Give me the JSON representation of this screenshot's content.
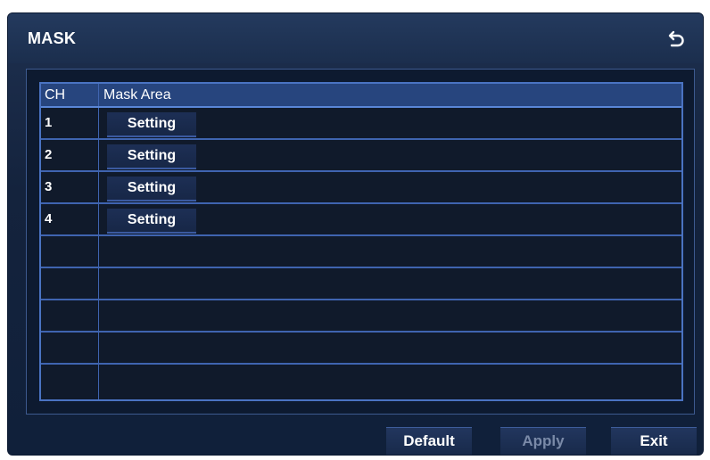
{
  "window": {
    "title": "MASK"
  },
  "table": {
    "columns": [
      "CH",
      "Mask Area"
    ],
    "rows": [
      {
        "ch": "1",
        "action": "Setting"
      },
      {
        "ch": "2",
        "action": "Setting"
      },
      {
        "ch": "3",
        "action": "Setting"
      },
      {
        "ch": "4",
        "action": "Setting"
      },
      {
        "ch": "",
        "action": ""
      },
      {
        "ch": "",
        "action": ""
      },
      {
        "ch": "",
        "action": ""
      },
      {
        "ch": "",
        "action": ""
      },
      {
        "ch": "",
        "action": ""
      }
    ]
  },
  "buttons": {
    "default": "Default",
    "apply": "Apply",
    "exit": "Exit"
  },
  "icons": {
    "back": "back-arrow-icon"
  },
  "colors": {
    "panel": "#14233d",
    "grid_line": "#3f64b0",
    "header_row": "#27457e"
  }
}
